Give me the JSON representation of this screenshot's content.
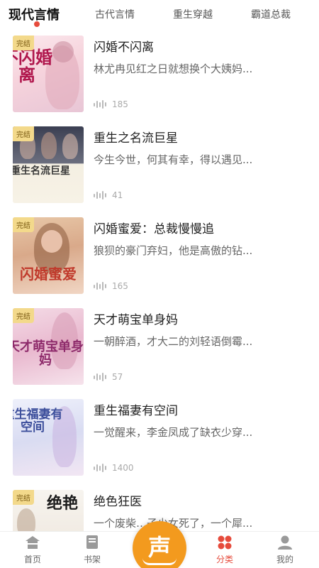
{
  "tabs": [
    {
      "label": "现代言情"
    },
    {
      "label": "古代言情"
    },
    {
      "label": "重生穿越"
    },
    {
      "label": "霸道总裁"
    }
  ],
  "books": [
    {
      "title": "闪婚不闪离",
      "desc": "林尤冉见红之日就想换个大姨妈...",
      "plays": "185",
      "badge": "完结",
      "cover_text": "不闪婚离"
    },
    {
      "title": "重生之名流巨星",
      "desc": "今生今世，何其有幸，得以遇见...",
      "plays": "41",
      "badge": "完结",
      "cover_text": "重生名流巨星"
    },
    {
      "title": "闪婚蜜爱：总裁慢慢追",
      "desc": "狼狈的豪门弃妇，他是高傲的钻...",
      "plays": "165",
      "badge": "完结",
      "cover_text": "闪婚蜜爱"
    },
    {
      "title": "天才萌宝单身妈",
      "desc": "一朝醉酒，才大二的刘轻语倒霉...",
      "plays": "57",
      "badge": "完结",
      "cover_text": "天才萌宝单身妈"
    },
    {
      "title": "重生福妻有空间",
      "desc": "一觉醒来，李金凤成了缺衣少穿...",
      "plays": "1400",
      "badge": "",
      "cover_text": "重生福妻有空间"
    },
    {
      "title": "绝色狂医",
      "desc": "一个废柴…子少女死了，一个犀...",
      "plays": "",
      "badge": "完结",
      "cover_text": "绝艳"
    }
  ],
  "nav": {
    "home": "首页",
    "shelf": "书架",
    "center_glyph": "声",
    "category": "分类",
    "mine": "我的"
  },
  "colors": {
    "accent": "#e64b3c",
    "center": "#f39a1e",
    "badge": "#f3d98b"
  }
}
